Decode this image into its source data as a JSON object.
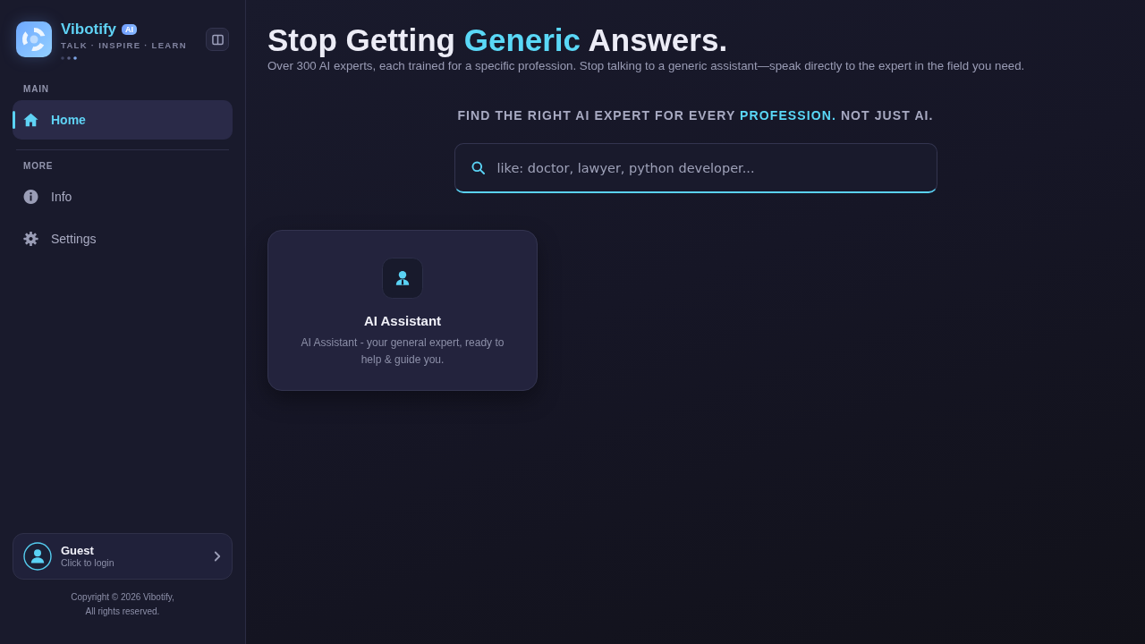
{
  "sidebar": {
    "brand": {
      "name": "Vibotify",
      "badge": "AI",
      "tagline": "TALK · INSPIRE · LEARN"
    },
    "sections": [
      {
        "heading": "MAIN",
        "items": [
          {
            "label": "Home",
            "selected": true
          }
        ]
      },
      {
        "heading": "MORE",
        "items": [
          {
            "label": "Info",
            "selected": false
          },
          {
            "label": "Settings",
            "selected": false
          }
        ]
      }
    ],
    "user": {
      "name": "Guest",
      "hint": "Click to login"
    },
    "copyright": "Copyright © 2026 Vibotify,\nAll rights reserved."
  },
  "header": {
    "title": "Stop Getting *Generic* Answers.",
    "subtitle": "Over 300 AI experts, each trained for a specific profession. Stop talking to a generic assistant—speak directly to the expert in the field you need."
  },
  "finder": {
    "tagline": "FIND THE RIGHT AI EXPERT FOR EVERY **PROFESSION.** NOT JUST AI.",
    "search": {
      "placeholder": "like: doctor, lawyer, python developer..."
    }
  },
  "experts": [
    {
      "title": "AI Assistant",
      "description": "AI Assistant - your general expert, ready to help & guide you."
    }
  ]
}
